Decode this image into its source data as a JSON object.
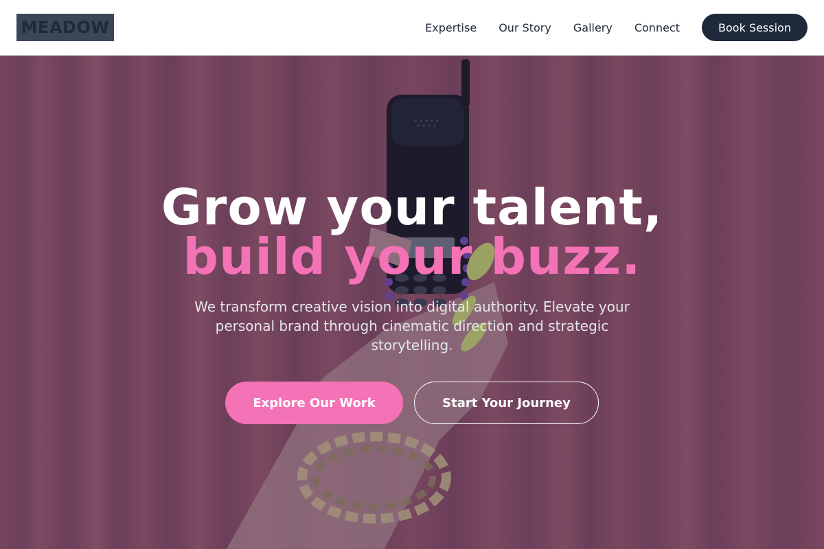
{
  "brand": {
    "logo_text": "MEADOW"
  },
  "nav": {
    "links": [
      "Expertise",
      "Our Story",
      "Gallery",
      "Connect"
    ],
    "cta_label": "Book Session"
  },
  "hero": {
    "headline_line1": "Grow your talent,",
    "headline_line2": "build your buzz.",
    "subtitle": "We transform creative vision into digital authority. Elevate your personal brand through cinematic direction and strategic storytelling.",
    "primary_button": "Explore Our Work",
    "secondary_button": "Start Your Journey",
    "image_description_icon": "hand-holding-phone-illustration"
  },
  "colors": {
    "accent_pink": "#f472b6",
    "navy": "#1e293b",
    "logo_bg": "#3b4658"
  }
}
